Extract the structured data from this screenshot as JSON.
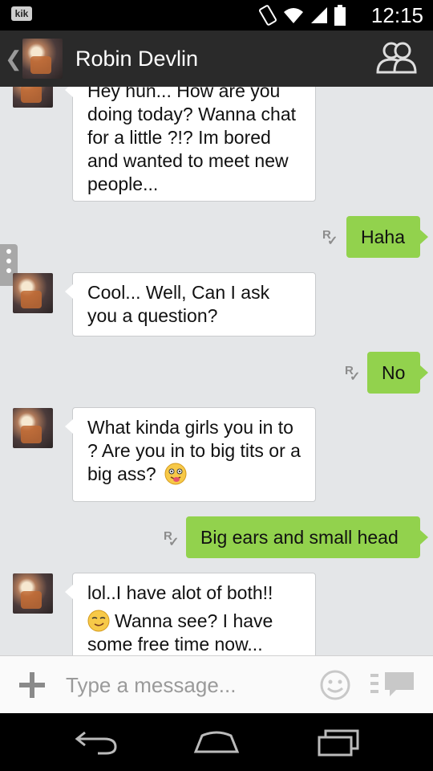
{
  "status_bar": {
    "app_badge": "kik",
    "time": "12:15"
  },
  "header": {
    "contact_name": "Robin Devlin"
  },
  "messages": [
    {
      "from": "them",
      "text": "Hey hun... How are you doing today? Wanna chat for a little ?!? Im bored and wanted to meet new people..."
    },
    {
      "from": "me",
      "text": "Haha",
      "receipt": "R"
    },
    {
      "from": "them",
      "text": "Cool... Well, Can I ask you a question?"
    },
    {
      "from": "me",
      "text": "No",
      "receipt": "R"
    },
    {
      "from": "them",
      "text": "What kinda girls you in to ? Are you in to big tits or a big ass?",
      "emoji": "tongue-out-face"
    },
    {
      "from": "me",
      "text": "Big ears and small head",
      "receipt": "R"
    },
    {
      "from": "them",
      "text_line1": "lol..I have alot of both!!",
      "emoji": "smirk-face",
      "text_line2": "Wanna see? I have",
      "text_line3": "some free time now..."
    }
  ],
  "composer": {
    "placeholder": "Type a message..."
  },
  "colors": {
    "outgoing_bubble": "#92d24d",
    "incoming_bubble": "#ffffff",
    "chat_background": "#e4e6e8",
    "app_bar": "#2a2a2a"
  }
}
